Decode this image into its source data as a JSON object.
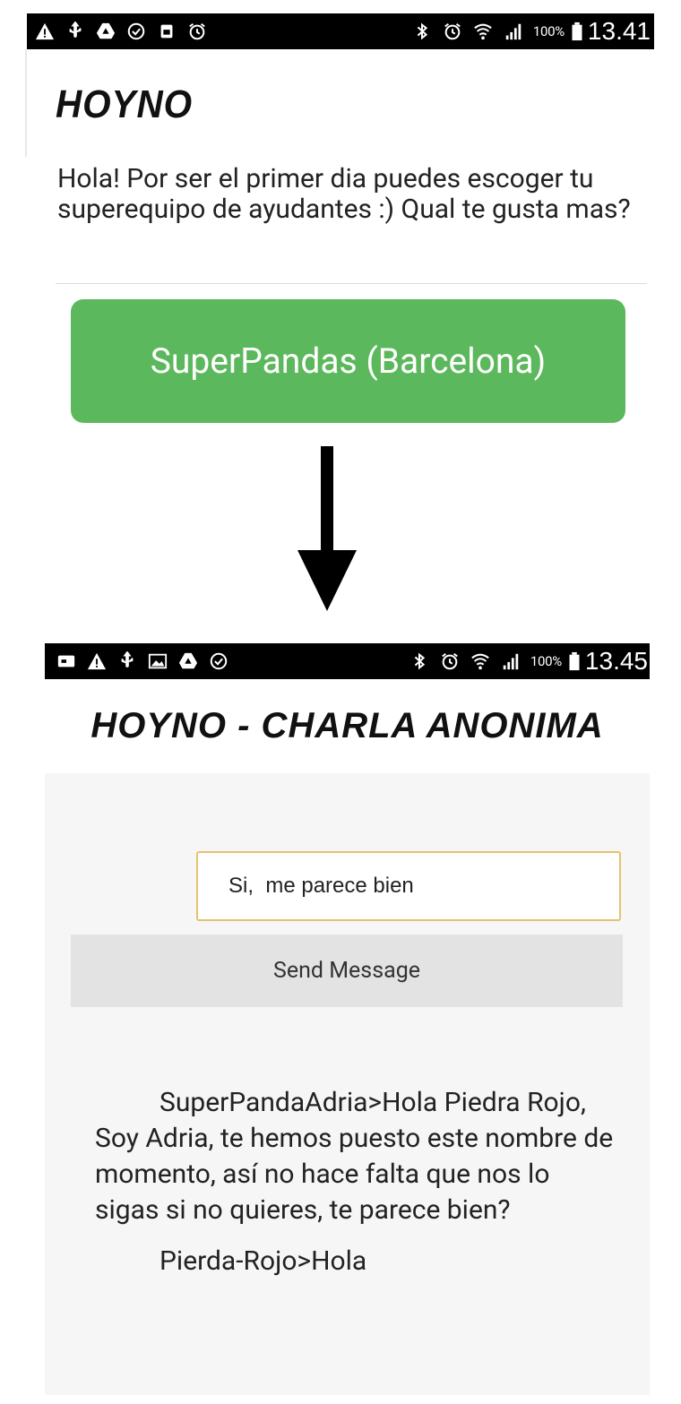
{
  "screen1": {
    "statusbar": {
      "left_icons": [
        "warning-icon",
        "usb-icon",
        "drive-icon",
        "check-circle-icon",
        "sim-icon",
        "alarm-icon"
      ],
      "right_icons": [
        "bluetooth-icon",
        "alarm-icon",
        "wifi-icon",
        "signal-icon"
      ],
      "battery": "100%",
      "time": "13.41"
    },
    "app_title": "HOYNO",
    "intro_text": "Hola! Por ser el primer dia puedes escoger tu superequipo de ayudantes :) Qual te gusta mas?",
    "team_button_label": "SuperPandas (Barcelona)",
    "team_button_color": "#5cb85c"
  },
  "transition_arrow": "arrow-down-icon",
  "screen2": {
    "statusbar": {
      "left_icons": [
        "message-icon",
        "warning-icon",
        "usb-icon",
        "image-icon",
        "drive-icon",
        "check-circle-icon"
      ],
      "right_icons": [
        "bluetooth-icon",
        "alarm-icon",
        "wifi-icon",
        "signal-icon"
      ],
      "battery": "100%",
      "time": "13.45"
    },
    "app_title": "HOYNO - CHARLA ANONIMA",
    "message_input_value": "Si,  me parece bien",
    "send_button_label": "Send Message",
    "chat_messages": [
      "SuperPandaAdria>Hola Piedra Rojo, Soy Adria, te hemos puesto este nombre de momento, así no hace falta que nos lo sigas si no quieres, te parece bien?",
      "Pierda-Rojo>Hola"
    ]
  }
}
